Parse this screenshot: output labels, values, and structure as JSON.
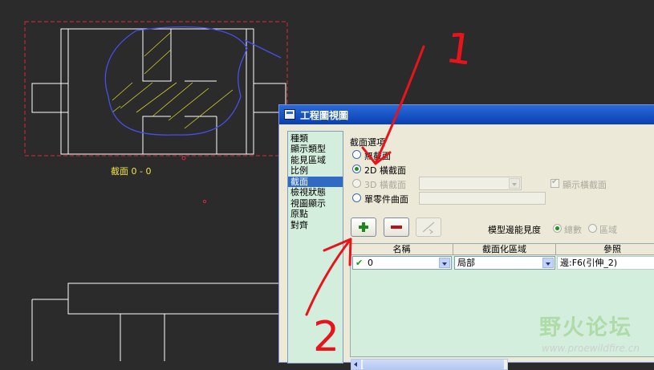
{
  "drawing": {
    "section_label": "截面  0 - 0"
  },
  "dialog": {
    "title": "工程圖視圖",
    "categories_header": "種類",
    "categories": [
      "顯示類型",
      "能見區域",
      "比例",
      "截面",
      "檢視狀態",
      "視圖顯示",
      "原點",
      "對齊"
    ],
    "selected_category": "截面",
    "section_options_label": "截面選項",
    "options": {
      "none": "無截面",
      "cross_2d": "2D 橫截面",
      "cross_3d": "3D 橫截面",
      "single_surface": "單零件曲面"
    },
    "selected_option": "2D 橫截面",
    "show_cross_section_label": "顯示橫截面",
    "model_edge_visibility_label": "模型邊能見度",
    "edge_total_label": "總數",
    "edge_area_label": "區域",
    "table": {
      "columns": [
        "名稱",
        "截面化區域",
        "參照"
      ],
      "row": {
        "name": "0",
        "area": "局部",
        "reference": "邊:F6(引伸_2)"
      }
    }
  },
  "watermark": {
    "brand": "野火论坛",
    "url": "www.proewildfire.cn"
  },
  "annotations": {
    "label_1": "1",
    "label_2": "2",
    "color": "#e8141c"
  }
}
